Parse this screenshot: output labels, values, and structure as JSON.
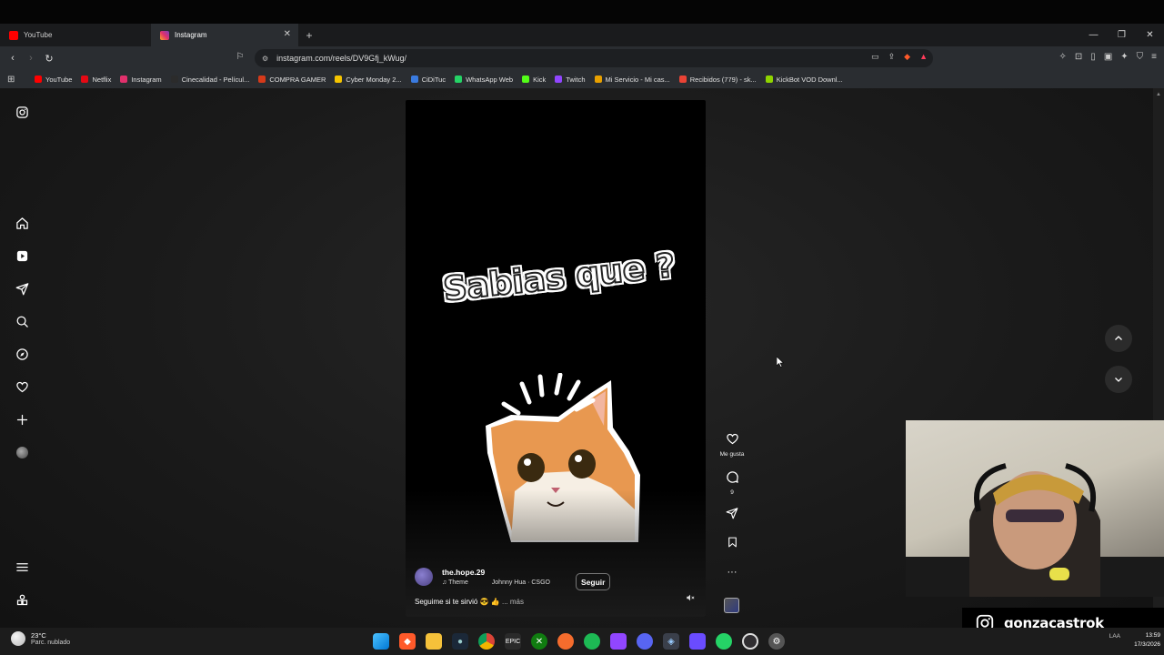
{
  "browser": {
    "tabs": [
      {
        "label": "YouTube",
        "icon": "youtube-icon",
        "color": "#ff0000"
      },
      {
        "label": "Instagram",
        "icon": "instagram-icon",
        "color": "#e1306c",
        "active": true
      }
    ],
    "new_tab": "+",
    "url": "instagram.com/reels/DV9Gfj_kWug/",
    "bookmarks": [
      {
        "label": "YouTube",
        "color": "#ff0000"
      },
      {
        "label": "Netflix",
        "color": "#e50914"
      },
      {
        "label": "Instagram",
        "color": "#e1306c"
      },
      {
        "label": "Cinecalidad - Películ...",
        "color": "#2b2b2b"
      },
      {
        "label": "COMPRA GAMER",
        "color": "#d63a1a"
      },
      {
        "label": "Cyber Monday 2...",
        "color": "#f5c400"
      },
      {
        "label": "CiDiTuc",
        "color": "#3a7be0"
      },
      {
        "label": "WhatsApp Web",
        "color": "#25d366"
      },
      {
        "label": "Kick",
        "color": "#53fc18"
      },
      {
        "label": "Twitch",
        "color": "#9146ff"
      },
      {
        "label": "Mi Servicio - Mi cas...",
        "color": "#e8a000"
      },
      {
        "label": "Recibidos (779) - sk...",
        "color": "#ea4335"
      },
      {
        "label": "KickBot VOD Downl...",
        "color": "#8fd400"
      }
    ]
  },
  "reel": {
    "overlay_text": "Sabias que ?",
    "username": "the.hope.29",
    "audio_left": "Theme",
    "audio_right": "Johnny Hua · CSGO",
    "follow_label": "Seguir",
    "caption": "Seguime si te sirvió 😎 👍",
    "caption_more": "... más",
    "like_label": "Me gusta",
    "comment_count": "9"
  },
  "stream": {
    "instagram_handle": "gonzacastrok"
  },
  "taskbar": {
    "temp": "23°C",
    "weather": "Parc. nublado",
    "lang": "LAA",
    "time": "13:59",
    "date": "17/3/2026"
  },
  "colors": {
    "accent_brave": "#ff5a2a",
    "page_bg": "#1a1a1a"
  }
}
